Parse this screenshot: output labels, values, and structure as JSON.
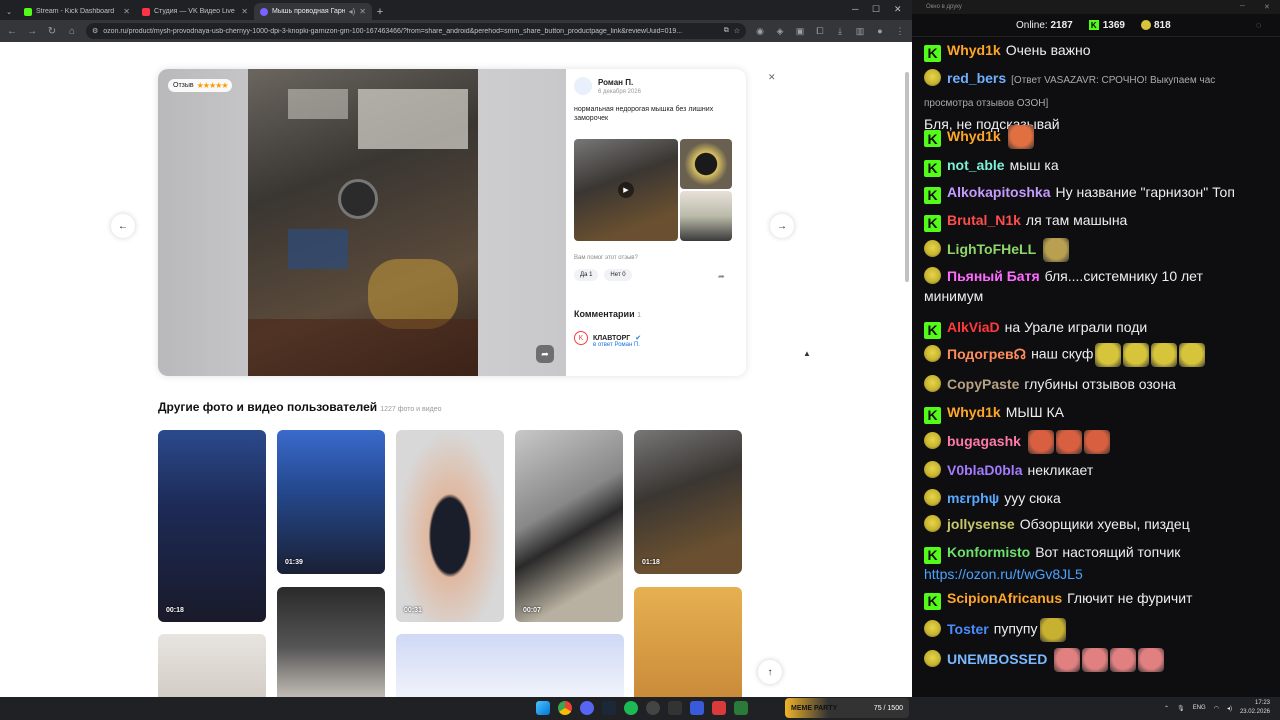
{
  "browser": {
    "tabs": [
      {
        "title": "Stream - Kick Dashboard",
        "color": "#53fc18",
        "active": false
      },
      {
        "title": "Студия — VK Видео Live",
        "color": "#ff3347",
        "active": false
      },
      {
        "title": "Мышь проводная Гарнизон",
        "color": "#7b61ff",
        "active": true
      }
    ],
    "url": "ozon.ru/product/mysh-provodnaya-usb-chernyy-1000-dpi-3-knopki-garnizon-gm-100-167463466/?from=share_android&perehod=smm_share_button_productpage_link&reviewUuid=019..."
  },
  "review": {
    "badge_label": "Отзыв",
    "stars": "★★★★★",
    "author_name": "Роман П.",
    "date": "6 декабря 2026",
    "text": "нормальная недорогая мышка без лишних заморочек",
    "helpful_q": "Вам помог этот отзыв?",
    "yes": "Да 1",
    "no": "Нет 0",
    "comments_label": "Комментарии",
    "comments_count": "1",
    "shop_name": "КЛАВТОРГ",
    "shop_sub": "в ответ Роман П."
  },
  "gallery": {
    "title": "Другие фото и видео пользователей",
    "count": "1227 фото и видео",
    "durations": [
      "00:18",
      "01:39",
      "00:31",
      "00:07",
      "01:18"
    ]
  },
  "chat": {
    "window_title": "Окно в друку",
    "online_label": "Online:",
    "online": "2187",
    "kick_count": "1369",
    "pepe_count": "818",
    "messages": [
      {
        "badge": "k",
        "user": "Whyd1k",
        "color": "#ffa628",
        "text": "Очень важно"
      },
      {
        "badge": "p",
        "user": "red_bers",
        "color": "#6fb0ff",
        "reply": "[Ответ VASAZAVR: СРОЧНО! Выкупаем час просмотра отзывов ОЗОН]",
        "text": "Бля, не подсказывай"
      },
      {
        "badge": "k",
        "user": "Whyd1k",
        "color": "#ffa628",
        "text": ""
      },
      {
        "badge": "k",
        "user": "not_able",
        "color": "#7ef0d8",
        "text": "мыш ка"
      },
      {
        "badge": "k",
        "user": "Alkokapitoshka",
        "color": "#c59bff",
        "text": "Ну название \"гарнизон\" Топ"
      },
      {
        "badge": "k",
        "user": "Brutal_N1k",
        "color": "#ff4d4d",
        "text": "ля там машына"
      },
      {
        "badge": "p",
        "user": "LighToFHeLL",
        "color": "#8fd66a",
        "text": ""
      },
      {
        "badge": "p",
        "user": "Пьяный Батя",
        "color": "#ff6bff",
        "text": "бля....системнику 10 лет минимум"
      },
      {
        "badge": "k",
        "user": "AlkViaD",
        "color": "#ff3a3a",
        "text": "на Урале играли поди"
      },
      {
        "badge": "p",
        "user": "Подогрев☊",
        "color": "#ff8c5a",
        "text": "наш скуф"
      },
      {
        "badge": "p",
        "user": "CopyPaste",
        "color": "#b5a282",
        "text": "глубины отзывов озона"
      },
      {
        "badge": "k",
        "user": "Whyd1k",
        "color": "#ffa628",
        "text": "МЫШ КА"
      },
      {
        "badge": "p",
        "user": "bugagashk",
        "color": "#ff7aa8",
        "text": ""
      },
      {
        "badge": "p",
        "user": "V0blaD0bla",
        "color": "#a47bff",
        "text": "некликает"
      },
      {
        "badge": "p",
        "user": "mεrphψ",
        "color": "#57a8ff",
        "text": "ууу сюка"
      },
      {
        "badge": "p",
        "user": "jollysense",
        "color": "#c8c86a",
        "text": "Обзорщики хуевы, пиздец"
      },
      {
        "badge": "k",
        "user": "Konformisto",
        "color": "#6be06b",
        "text": "Вот настоящий топчик",
        "link": "https://ozon.ru/t/wGv8JL5"
      },
      {
        "badge": "k",
        "user": "ScipionAfricanus",
        "color": "#ffa628",
        "text": "Глючит не фуричит"
      },
      {
        "badge": "p",
        "user": "Toster",
        "color": "#4a8cff",
        "text": "пупупу"
      },
      {
        "badge": "p",
        "user": "UNEMBOSSED",
        "color": "#7ab8ff",
        "text": ""
      }
    ]
  },
  "taskbar": {
    "meme_label": "MEME PARTY",
    "meme_progress": "75 / 1500",
    "lang": "ENG",
    "time": "17:23",
    "date": "23.02.2026"
  }
}
